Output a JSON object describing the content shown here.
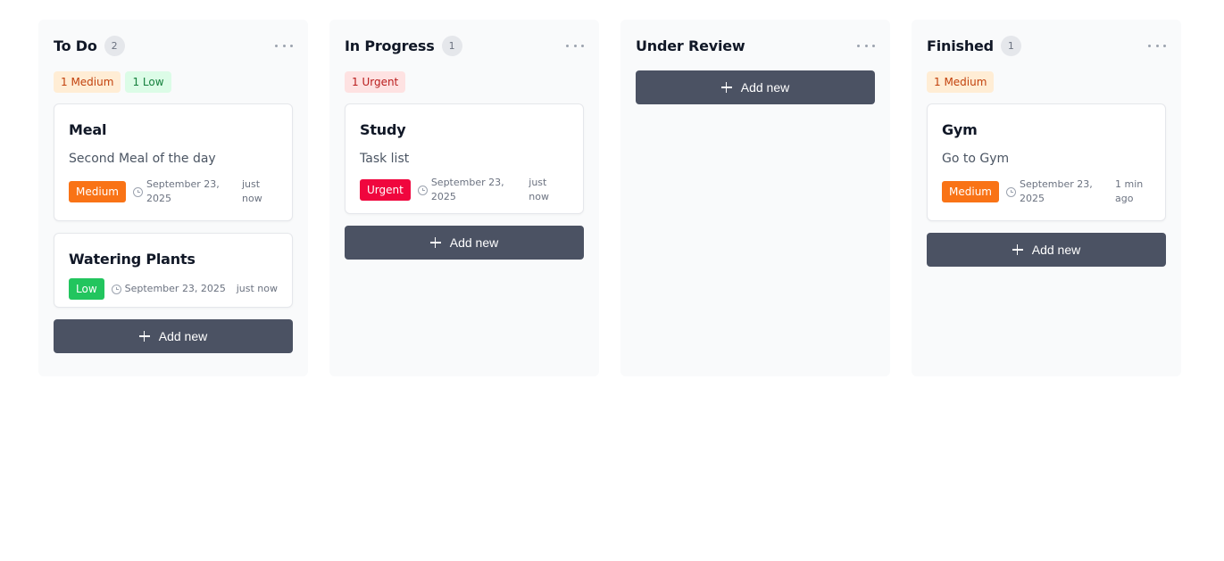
{
  "columns": [
    {
      "title": "To Do",
      "count": "2",
      "summary": [
        {
          "label": "1 Medium",
          "kind": "medium"
        },
        {
          "label": "1 Low",
          "kind": "low"
        }
      ],
      "cards": [
        {
          "title": "Meal",
          "description": "Second Meal of the day",
          "priority": "Medium",
          "date": "September 23, 2025",
          "relative": "just now"
        },
        {
          "title": "Watering Plants",
          "description": "",
          "priority": "Low",
          "date": "September 23, 2025",
          "relative": "just now"
        }
      ],
      "add_label": "Add new"
    },
    {
      "title": "In Progress",
      "count": "1",
      "summary": [
        {
          "label": "1 Urgent",
          "kind": "urgent"
        }
      ],
      "cards": [
        {
          "title": "Study",
          "description": "Task list",
          "priority": "Urgent",
          "date": "September 23, 2025",
          "relative": "just now"
        }
      ],
      "add_label": "Add new"
    },
    {
      "title": "Under Review",
      "count": "",
      "summary": [],
      "cards": [],
      "add_label": "Add new"
    },
    {
      "title": "Finished",
      "count": "1",
      "summary": [
        {
          "label": "1 Medium",
          "kind": "medium"
        }
      ],
      "cards": [
        {
          "title": "Gym",
          "description": "Go to Gym",
          "priority": "Medium",
          "date": "September 23, 2025",
          "relative": "1 min ago"
        }
      ],
      "add_label": "Add new"
    }
  ],
  "colors": {
    "medium": "#f97316",
    "low": "#22c55e",
    "urgent": "#f0063e",
    "button": "#4b5263"
  },
  "icons": {
    "more": "more-horizontal-icon",
    "clock": "clock-icon",
    "plus": "plus-icon"
  }
}
